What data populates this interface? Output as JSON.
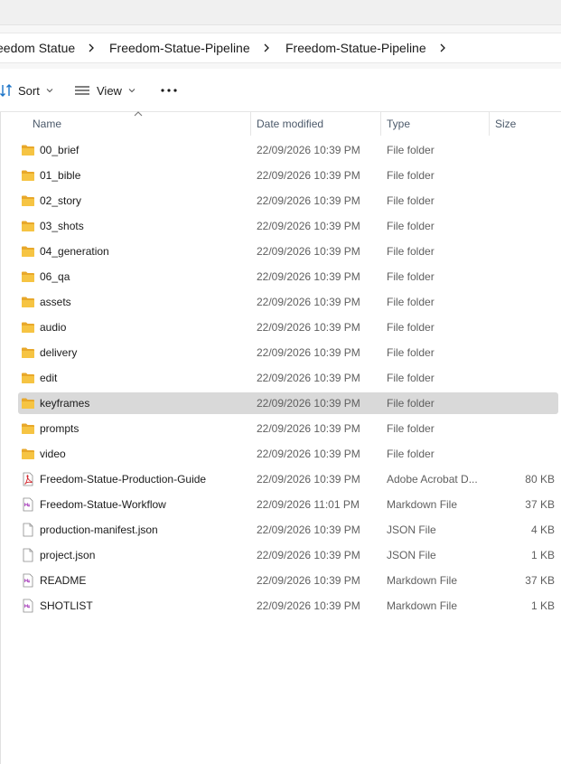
{
  "breadcrumb": {
    "items": [
      "eedom Statue",
      "Freedom-Statue-Pipeline",
      "Freedom-Statue-Pipeline"
    ]
  },
  "toolbar": {
    "sort_label": "Sort",
    "view_label": "View",
    "more_label": "···"
  },
  "columns": {
    "name": "Name",
    "date": "Date modified",
    "type": "Type",
    "size": "Size"
  },
  "files": [
    {
      "name": "00_brief",
      "date": "22/09/2026 10:39 PM",
      "type": "File folder",
      "size": "",
      "icon": "folder-icon"
    },
    {
      "name": "01_bible",
      "date": "22/09/2026 10:39 PM",
      "type": "File folder",
      "size": "",
      "icon": "folder-icon"
    },
    {
      "name": "02_story",
      "date": "22/09/2026 10:39 PM",
      "type": "File folder",
      "size": "",
      "icon": "folder-icon"
    },
    {
      "name": "03_shots",
      "date": "22/09/2026 10:39 PM",
      "type": "File folder",
      "size": "",
      "icon": "folder-icon"
    },
    {
      "name": "04_generation",
      "date": "22/09/2026 10:39 PM",
      "type": "File folder",
      "size": "",
      "icon": "folder-icon"
    },
    {
      "name": "06_qa",
      "date": "22/09/2026 10:39 PM",
      "type": "File folder",
      "size": "",
      "icon": "folder-icon"
    },
    {
      "name": "assets",
      "date": "22/09/2026 10:39 PM",
      "type": "File folder",
      "size": "",
      "icon": "folder-icon"
    },
    {
      "name": "audio",
      "date": "22/09/2026 10:39 PM",
      "type": "File folder",
      "size": "",
      "icon": "folder-icon"
    },
    {
      "name": "delivery",
      "date": "22/09/2026 10:39 PM",
      "type": "File folder",
      "size": "",
      "icon": "folder-icon"
    },
    {
      "name": "edit",
      "date": "22/09/2026 10:39 PM",
      "type": "File folder",
      "size": "",
      "icon": "folder-icon"
    },
    {
      "name": "keyframes",
      "date": "22/09/2026 10:39 PM",
      "type": "File folder",
      "size": "",
      "icon": "folder-icon",
      "selected": true
    },
    {
      "name": "prompts",
      "date": "22/09/2026 10:39 PM",
      "type": "File folder",
      "size": "",
      "icon": "folder-icon"
    },
    {
      "name": "video",
      "date": "22/09/2026 10:39 PM",
      "type": "File folder",
      "size": "",
      "icon": "folder-icon"
    },
    {
      "name": "Freedom-Statue-Production-Guide",
      "date": "22/09/2026 10:39 PM",
      "type": "Adobe Acrobat D...",
      "size": "80 KB",
      "icon": "pdf-file-icon"
    },
    {
      "name": "Freedom-Statue-Workflow",
      "date": "22/09/2026 11:01 PM",
      "type": "Markdown File",
      "size": "37 KB",
      "icon": "markdown-file-icon"
    },
    {
      "name": "production-manifest.json",
      "date": "22/09/2026 10:39 PM",
      "type": "JSON File",
      "size": "4 KB",
      "icon": "json-file-icon"
    },
    {
      "name": "project.json",
      "date": "22/09/2026 10:39 PM",
      "type": "JSON File",
      "size": "1 KB",
      "icon": "json-file-icon"
    },
    {
      "name": "README",
      "date": "22/09/2026 10:39 PM",
      "type": "Markdown File",
      "size": "37 KB",
      "icon": "markdown-file-icon"
    },
    {
      "name": "SHOTLIST",
      "date": "22/09/2026 10:39 PM",
      "type": "Markdown File",
      "size": "1 KB",
      "icon": "markdown-file-icon"
    }
  ],
  "colors": {
    "folder": "#f6c443",
    "folder_dark": "#e8a82b",
    "selected_row": "#d9d9d9",
    "pdf_accent": "#d2232a",
    "md_accent": "#b04fc2"
  }
}
